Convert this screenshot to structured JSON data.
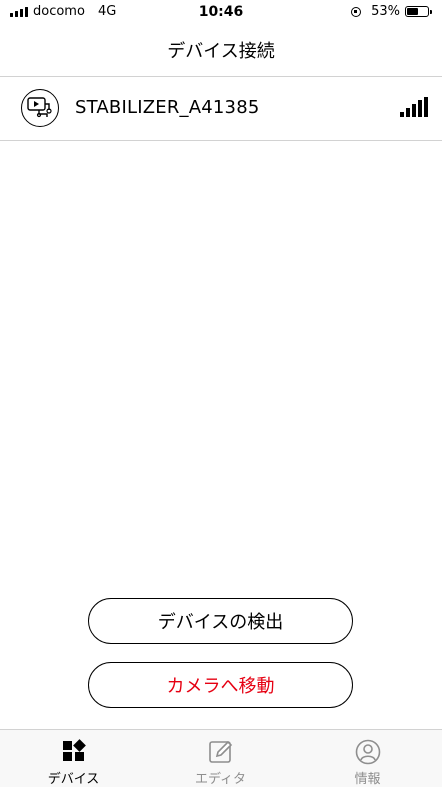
{
  "status_bar": {
    "carrier": "docomo",
    "network": "4G",
    "time": "10:46",
    "battery_percent": "53%",
    "battery_level": 0.53
  },
  "nav": {
    "title": "デバイス接続"
  },
  "devices": [
    {
      "name": "STABILIZER_A41385",
      "icon": "stabilizer-camera-icon",
      "signal": "signal-strength-icon"
    }
  ],
  "buttons": {
    "detect_label": "デバイスの検出",
    "camera_label": "カメラへ移動",
    "camera_color": "#e60012"
  },
  "tabbar": {
    "items": [
      {
        "label": "デバイス",
        "icon": "devices-icon",
        "active": true
      },
      {
        "label": "エディタ",
        "icon": "edit-icon",
        "active": false
      },
      {
        "label": "情報",
        "icon": "user-info-icon",
        "active": false
      }
    ]
  }
}
